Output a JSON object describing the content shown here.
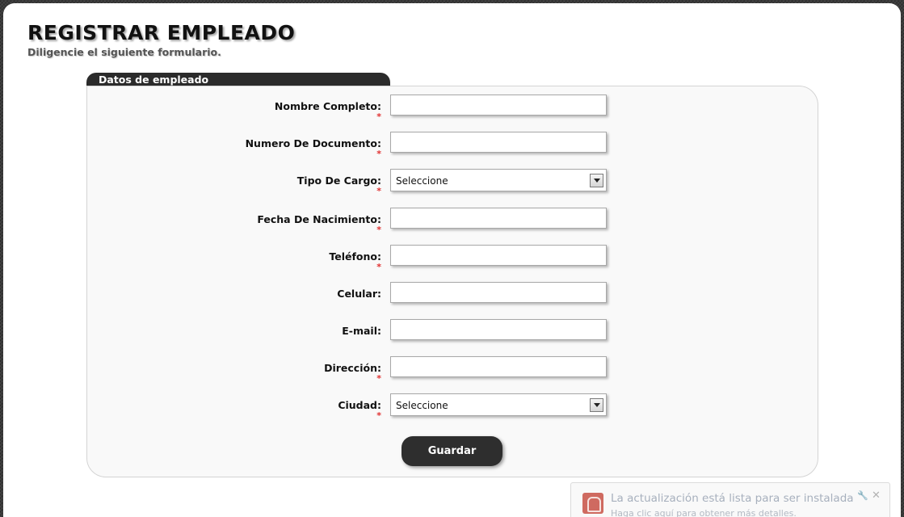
{
  "header": {
    "title": "REGISTRAR EMPLEADO",
    "subtitle": "Diligencie el siguiente formulario."
  },
  "form": {
    "tab_label": "Datos de empleado",
    "required_mark": "*",
    "fields": [
      {
        "label": "Nombre Completo:",
        "type": "text",
        "value": "",
        "required": true
      },
      {
        "label": "Numero De Documento:",
        "type": "text",
        "value": "",
        "required": true
      },
      {
        "label": "Tipo De Cargo:",
        "type": "select",
        "value": "Seleccione",
        "required": true
      },
      {
        "label": "Fecha De Nacimiento:",
        "type": "text",
        "value": "",
        "required": true
      },
      {
        "label": "Teléfono:",
        "type": "text",
        "value": "",
        "required": true
      },
      {
        "label": "Celular:",
        "type": "text",
        "value": "",
        "required": false
      },
      {
        "label": "E-mail:",
        "type": "text",
        "value": "",
        "required": false
      },
      {
        "label": "Dirección:",
        "type": "text",
        "value": "",
        "required": true
      },
      {
        "label": "Ciudad:",
        "type": "select",
        "value": "Seleccione",
        "required": true
      }
    ],
    "submit_label": "Guardar"
  },
  "notification": {
    "title": "La actualización está lista para ser instalada",
    "subtitle": "Haga clic aquí para obtener más detalles.",
    "wrench_glyph": "🔧",
    "close_glyph": "✕"
  },
  "colors": {
    "required": "#e03030",
    "button": "#2e2e2e",
    "tab": "#2b2b2b"
  }
}
